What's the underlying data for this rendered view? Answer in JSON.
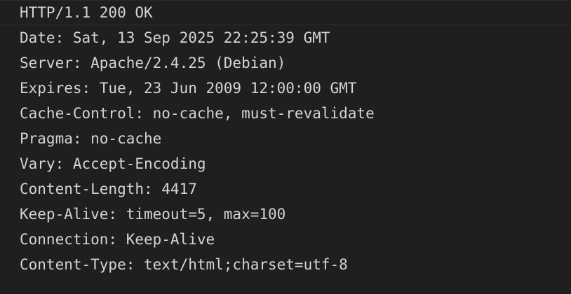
{
  "editor": {
    "lines": [
      "HTTP/1.1 200 OK",
      "Date: Sat, 13 Sep 2025 22:25:39 GMT",
      "Server: Apache/2.4.25 (Debian)",
      "Expires: Tue, 23 Jun 2009 12:00:00 GMT",
      "Cache-Control: no-cache, must-revalidate",
      "Pragma: no-cache",
      "Vary: Accept-Encoding",
      "Content-Length: 4417",
      "Keep-Alive: timeout=5, max=100",
      "Connection: Keep-Alive",
      "Content-Type: text/html;charset=utf-8"
    ]
  }
}
